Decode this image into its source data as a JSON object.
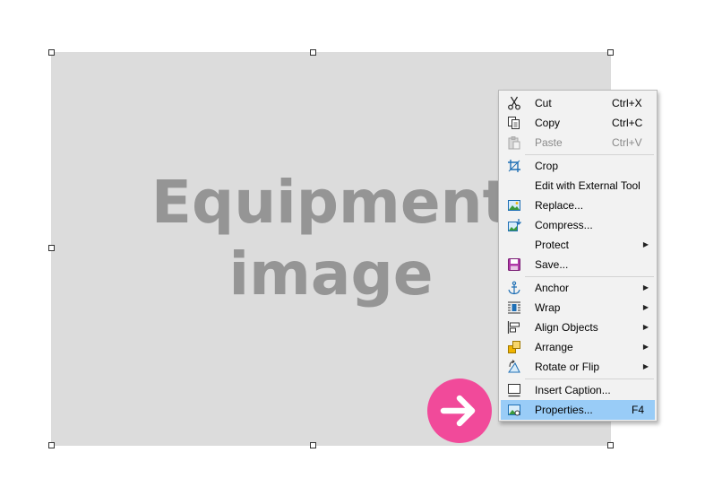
{
  "image": {
    "placeholder_line1": "Equipment",
    "placeholder_line2": "image"
  },
  "context_menu": {
    "items": [
      {
        "label": "Cut",
        "shortcut": "Ctrl+X",
        "icon": "scissors-icon",
        "enabled": true
      },
      {
        "label": "Copy",
        "shortcut": "Ctrl+C",
        "icon": "copy-icon",
        "enabled": true
      },
      {
        "label": "Paste",
        "shortcut": "Ctrl+V",
        "icon": "paste-icon",
        "enabled": false
      },
      {
        "label": "Crop",
        "icon": "crop-icon",
        "enabled": true
      },
      {
        "label": "Edit with External Tool",
        "enabled": true
      },
      {
        "label": "Replace...",
        "icon": "replace-image-icon",
        "enabled": true
      },
      {
        "label": "Compress...",
        "icon": "compress-image-icon",
        "enabled": true
      },
      {
        "label": "Protect",
        "submenu": true,
        "enabled": true
      },
      {
        "label": "Save...",
        "icon": "save-icon",
        "enabled": true
      },
      {
        "label": "Anchor",
        "icon": "anchor-icon",
        "submenu": true,
        "enabled": true
      },
      {
        "label": "Wrap",
        "icon": "wrap-icon",
        "submenu": true,
        "enabled": true
      },
      {
        "label": "Align Objects",
        "icon": "align-objects-icon",
        "submenu": true,
        "enabled": true
      },
      {
        "label": "Arrange",
        "icon": "arrange-icon",
        "submenu": true,
        "enabled": true
      },
      {
        "label": "Rotate or Flip",
        "icon": "rotate-flip-icon",
        "submenu": true,
        "enabled": true
      },
      {
        "label": "Insert Caption...",
        "icon": "caption-icon",
        "enabled": true
      },
      {
        "label": "Properties...",
        "shortcut": "F4",
        "icon": "properties-icon",
        "enabled": true,
        "highlighted": true
      }
    ]
  },
  "pointer": {
    "icon": "arrow-right-icon",
    "color": "#f14a9a"
  },
  "colors": {
    "highlight": "#99ccf7",
    "placeholder_bg": "#dcdcdc"
  }
}
